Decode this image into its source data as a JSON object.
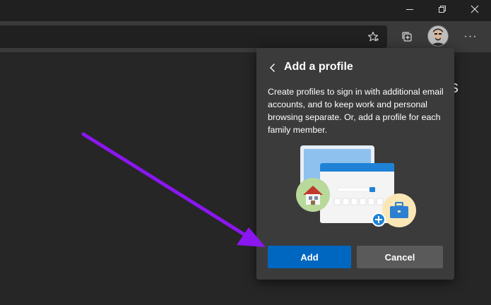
{
  "window": {
    "controls": [
      {
        "name": "minimize-button",
        "icon": "minimize-icon"
      },
      {
        "name": "restore-button",
        "icon": "restore-icon"
      },
      {
        "name": "close-button",
        "icon": "close-icon"
      }
    ]
  },
  "toolbar": {
    "favorite_icon": "star-outline-icon",
    "collections_icon": "collections-icon",
    "profile_icon": "avatar",
    "more_label": "···"
  },
  "content": {
    "partial_text": "s"
  },
  "flyout": {
    "title": "Add a profile",
    "description": "Create profiles to sign in with additional email accounts, and to keep work and personal browsing separate. Or, add a profile for each family member.",
    "add_label": "Add",
    "cancel_label": "Cancel"
  },
  "colors": {
    "accent": "#0067c0",
    "annotation_arrow": "#8a16f0",
    "flyout_bg": "#3b3b3b",
    "toolbar_bg": "#3a3a3a"
  }
}
